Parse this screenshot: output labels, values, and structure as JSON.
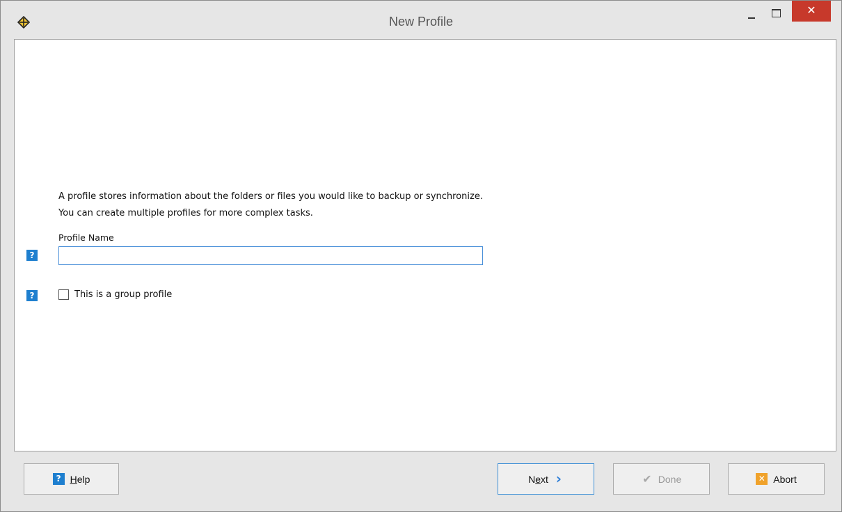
{
  "window": {
    "title": "New Profile",
    "close_glyph": "✕"
  },
  "intro": {
    "line1": "A profile stores information about the folders or files you would like to backup or synchronize.",
    "line2": "You can create multiple profiles for more complex tasks."
  },
  "profile_name": {
    "label": "Profile Name",
    "value": "",
    "placeholder": ""
  },
  "group_profile": {
    "label": "This is a group profile",
    "checked": false
  },
  "help_glyph": "?",
  "buttons": {
    "help": {
      "pre": "",
      "mnemonic": "H",
      "post": "elp",
      "icon": "help-icon"
    },
    "next": {
      "pre": "N",
      "mnemonic": "e",
      "post": "xt",
      "icon": "chevron-right-icon",
      "glyph": "›"
    },
    "done": {
      "label": "Done",
      "icon": "checkmark-icon",
      "glyph": "✔",
      "enabled": false
    },
    "abort": {
      "label": "Abort",
      "icon": "abort-icon",
      "glyph": "✕"
    }
  },
  "colors": {
    "accent": "#1e7fcf",
    "close": "#c7392b",
    "abort_icon": "#f0a22b"
  }
}
